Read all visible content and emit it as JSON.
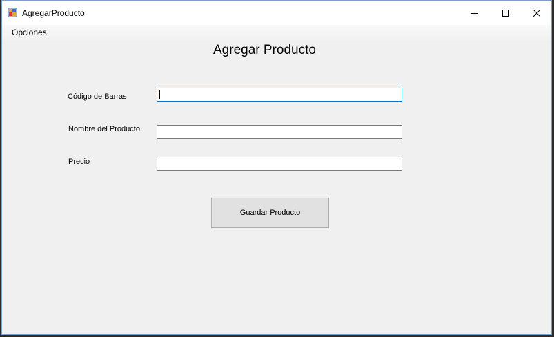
{
  "window": {
    "title": "AgregarProducto"
  },
  "menu": {
    "items": [
      {
        "label": "Opciones"
      }
    ]
  },
  "form": {
    "title": "Agregar Producto",
    "fields": [
      {
        "label": "Código de Barras",
        "value": ""
      },
      {
        "label": "Nombre del Producto",
        "value": ""
      },
      {
        "label": "Precio",
        "value": ""
      }
    ],
    "save_button_label": "Guardar Producto"
  },
  "colors": {
    "window_background": "#f0f0f0",
    "focus_border": "#0078d7",
    "button_background": "#e1e1e1"
  },
  "icons": [
    "app-icon",
    "minimize-icon",
    "maximize-icon",
    "close-icon"
  ]
}
